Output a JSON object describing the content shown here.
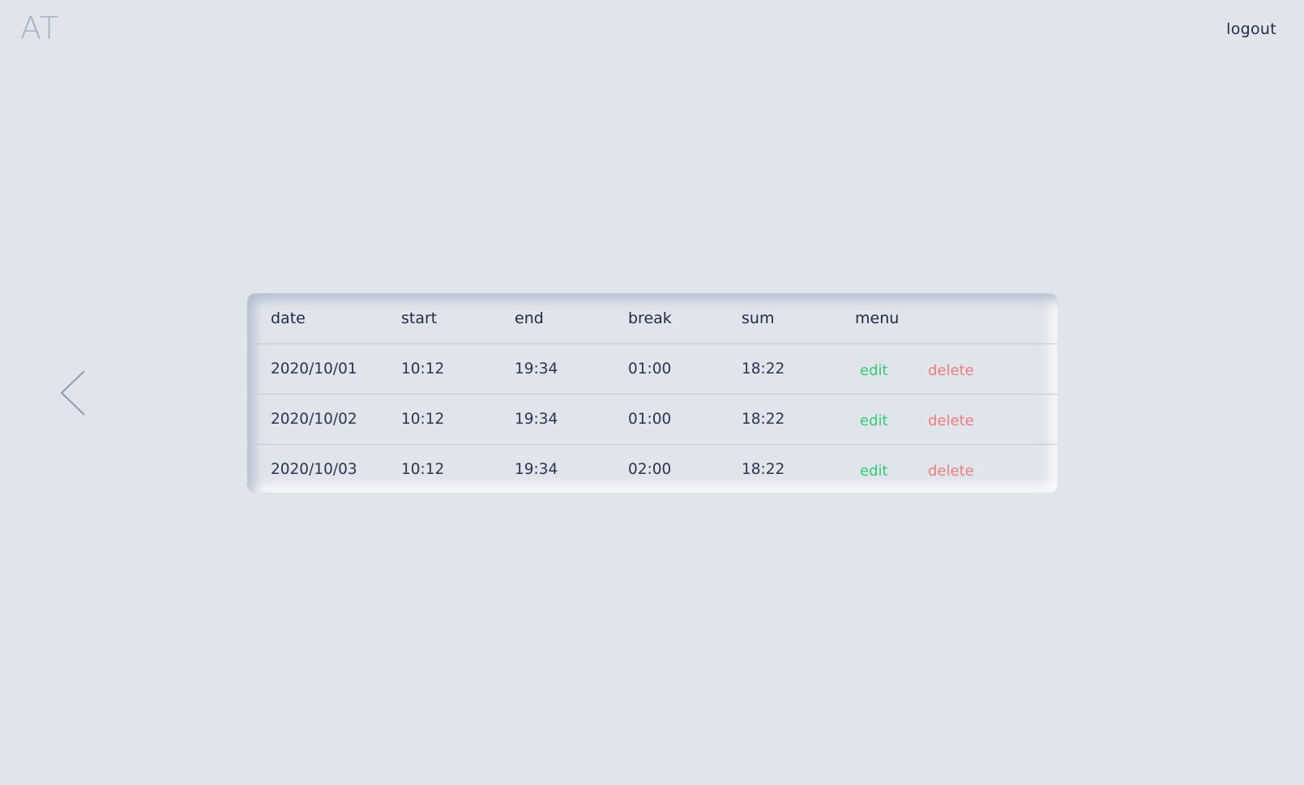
{
  "app": {
    "logo": "AT",
    "logout_label": "logout"
  },
  "table": {
    "headers": {
      "date": "date",
      "start": "start",
      "end": "end",
      "break": "break",
      "sum": "sum",
      "menu": "menu"
    },
    "rows": [
      {
        "date": "2020/10/01",
        "start": "10:12",
        "end": "19:34",
        "break": "01:00",
        "sum": "18:22",
        "edit": "edit",
        "delete": "delete"
      },
      {
        "date": "2020/10/02",
        "start": "10:12",
        "end": "19:34",
        "break": "01:00",
        "sum": "18:22",
        "edit": "edit",
        "delete": "delete"
      },
      {
        "date": "2020/10/03",
        "start": "10:12",
        "end": "19:34",
        "break": "02:00",
        "sum": "18:22",
        "edit": "edit",
        "delete": "delete"
      }
    ]
  },
  "icons": {
    "prev": "chevron-left-icon"
  },
  "colors": {
    "background": "#e0e5ec",
    "logo": "#a3b0c6",
    "text": "#1d2a44",
    "edit": "#2ecc71",
    "delete": "#f07b7b",
    "arrow": "#8f9bb3"
  }
}
